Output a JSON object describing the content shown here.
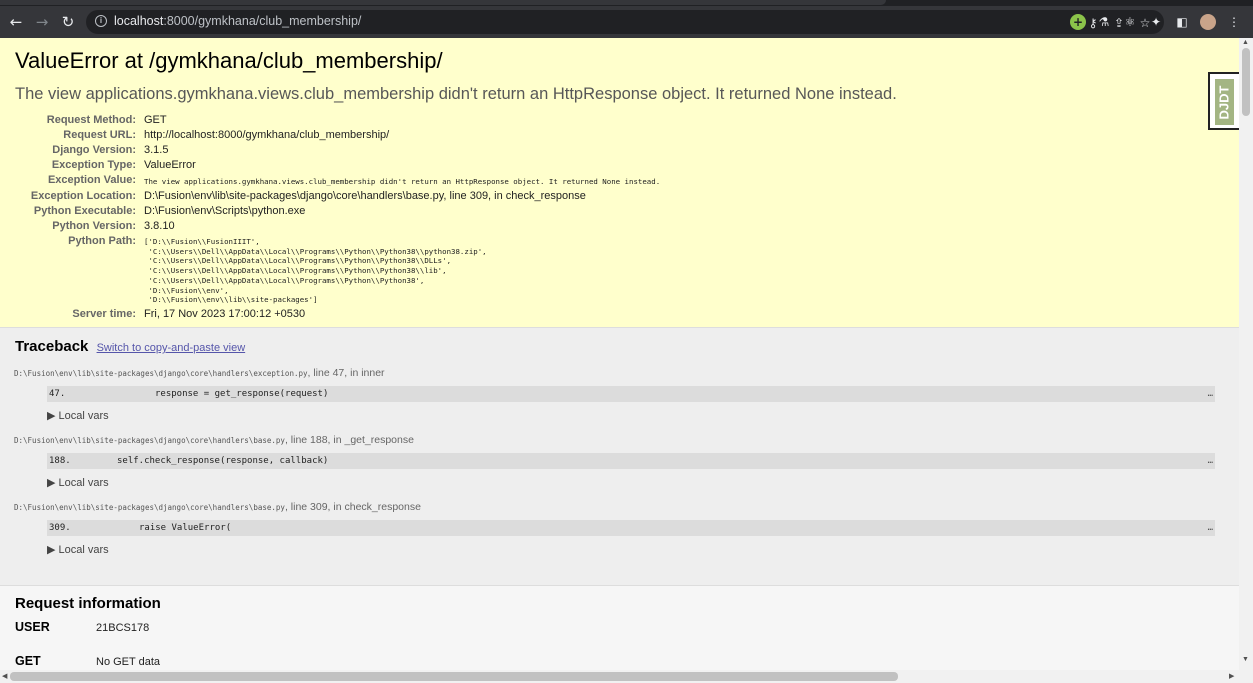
{
  "browser": {
    "url_host": "localhost",
    "url_rest": ":8000/gymkhana/club_membership/"
  },
  "summary": {
    "title": "ValueError at /gymkhana/club_membership/",
    "message": "The view applications.gymkhana.views.club_membership didn't return an HttpResponse object. It returned None instead.",
    "meta": [
      {
        "label": "Request Method:",
        "value": "GET"
      },
      {
        "label": "Request URL:",
        "value": "http://localhost:8000/gymkhana/club_membership/"
      },
      {
        "label": "Django Version:",
        "value": "3.1.5"
      },
      {
        "label": "Exception Type:",
        "value": "ValueError"
      },
      {
        "label": "Exception Value:",
        "value": "The view applications.gymkhana.views.club_membership didn't return an HttpResponse object. It returned None instead."
      },
      {
        "label": "Exception Location:",
        "value": "D:\\Fusion\\env\\lib\\site-packages\\django\\core\\handlers\\base.py, line 309, in check_response"
      },
      {
        "label": "Python Executable:",
        "value": "D:\\Fusion\\env\\Scripts\\python.exe"
      },
      {
        "label": "Python Version:",
        "value": "3.8.10"
      },
      {
        "label": "Python Path:",
        "value": "['D:\\\\Fusion\\\\FusionIIIT',\n 'C:\\\\Users\\\\Dell\\\\AppData\\\\Local\\\\Programs\\\\Python\\\\Python38\\\\python38.zip',\n 'C:\\\\Users\\\\Dell\\\\AppData\\\\Local\\\\Programs\\\\Python\\\\Python38\\\\DLLs',\n 'C:\\\\Users\\\\Dell\\\\AppData\\\\Local\\\\Programs\\\\Python\\\\Python38\\\\lib',\n 'C:\\\\Users\\\\Dell\\\\AppData\\\\Local\\\\Programs\\\\Python\\\\Python38',\n 'D:\\\\Fusion\\\\env',\n 'D:\\\\Fusion\\\\env\\\\lib\\\\site-packages']"
      },
      {
        "label": "Server time:",
        "value": "Fri, 17 Nov 2023 17:00:12 +0530"
      }
    ]
  },
  "traceback": {
    "title": "Traceback",
    "switch_link": "Switch to copy-and-paste view",
    "frames": [
      {
        "file": "D:\\Fusion\\env\\lib\\site-packages\\django\\core\\handlers\\exception.py",
        "where": ", line 47, in inner",
        "line_no": "47.",
        "code": "response = get_response(request)",
        "local_vars": "▶ Local vars"
      },
      {
        "file": "D:\\Fusion\\env\\lib\\site-packages\\django\\core\\handlers\\base.py",
        "where": ", line 188, in _get_response",
        "line_no": "188.",
        "code": "self.check_response(response, callback)",
        "local_vars": "▶ Local vars"
      },
      {
        "file": "D:\\Fusion\\env\\lib\\site-packages\\django\\core\\handlers\\base.py",
        "where": ", line 309, in check_response",
        "line_no": "309.",
        "code": "raise ValueError(",
        "local_vars": "▶ Local vars"
      }
    ],
    "ellipsis": "…"
  },
  "request_info": {
    "title": "Request information",
    "rows": [
      {
        "key": "USER",
        "value": "21BCS178"
      },
      {
        "key": "GET",
        "value": "No GET data"
      }
    ]
  },
  "djdt_label": "DJDT",
  "icons": {
    "back": "back-arrow-icon",
    "forward": "forward-arrow-icon",
    "reload": "reload-icon"
  }
}
